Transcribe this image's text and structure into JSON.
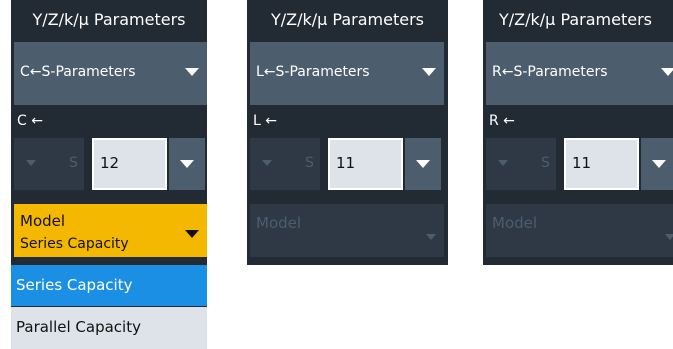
{
  "panels": [
    {
      "title": "Y/Z/k/μ Parameters",
      "dropdown": "C←S-Parameters",
      "label": "C ←",
      "spin_label": "S",
      "value": "12",
      "model_title": "Model",
      "model_value": "Series Capacity",
      "model_active": true,
      "options": [
        "Series Capacity",
        "Parallel Capacity"
      ],
      "selected_option": "Series Capacity"
    },
    {
      "title": "Y/Z/k/μ Parameters",
      "dropdown": "L←S-Parameters",
      "label": "L ←",
      "spin_label": "S",
      "value": "11",
      "model_title": "Model",
      "model_active": false
    },
    {
      "title": "Y/Z/k/μ Parameters",
      "dropdown": "R←S-Parameters",
      "label": "R ←",
      "spin_label": "S",
      "value": "11",
      "model_title": "Model",
      "model_active": false
    }
  ],
  "colors": {
    "panel_bg": "#222a33",
    "control_bg": "#4c5d6e",
    "active_accent": "#f5b800",
    "selected_option": "#1a8fe3",
    "option_bg": "#dde3e8"
  },
  "icons": {
    "dropdown_arrow": "chevron-down-icon"
  }
}
